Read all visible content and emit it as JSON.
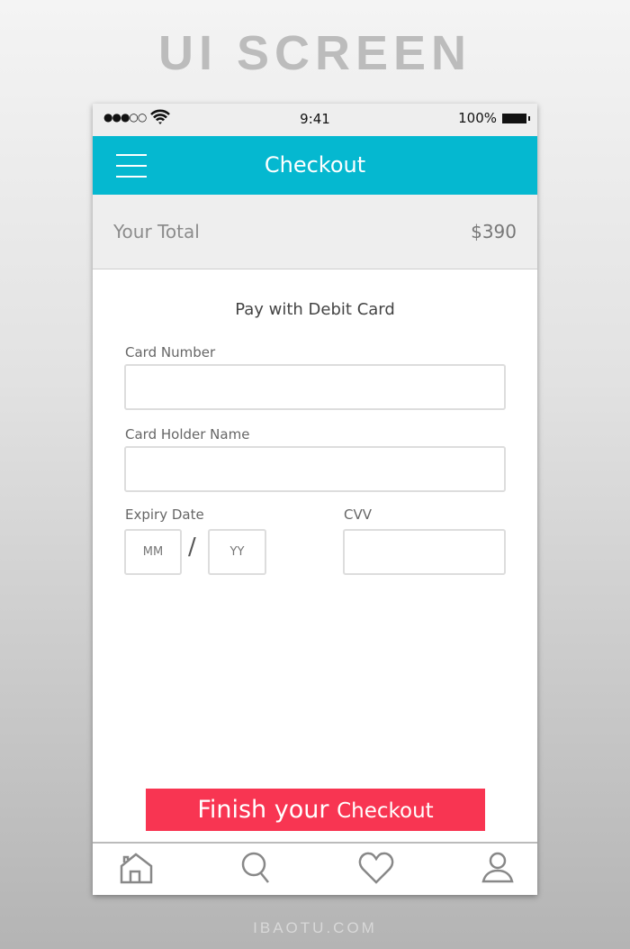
{
  "banner": {
    "title": "UI SCREEN",
    "footer": "IBAOTU.COM"
  },
  "status": {
    "signal": "●●●○○",
    "time": "9:41",
    "battery": "100%"
  },
  "header": {
    "title": "Checkout"
  },
  "total": {
    "label": "Your Total",
    "amount": "$390"
  },
  "form": {
    "heading": "Pay with Debit Card",
    "card_number_label": "Card Number",
    "card_number_value": "",
    "holder_label": "Card Holder Name",
    "holder_value": "",
    "expiry_label": "Expiry Date",
    "month_placeholder": "MM",
    "year_placeholder": "YY",
    "separator": "/",
    "cvv_label": "CVV",
    "cvv_value": ""
  },
  "button": {
    "main": "Finish your ",
    "small": "Checkout"
  },
  "colors": {
    "header": "#05b8d0",
    "button": "#f83552"
  },
  "tabbar": [
    "home-icon",
    "search-icon",
    "heart-icon",
    "user-icon"
  ]
}
